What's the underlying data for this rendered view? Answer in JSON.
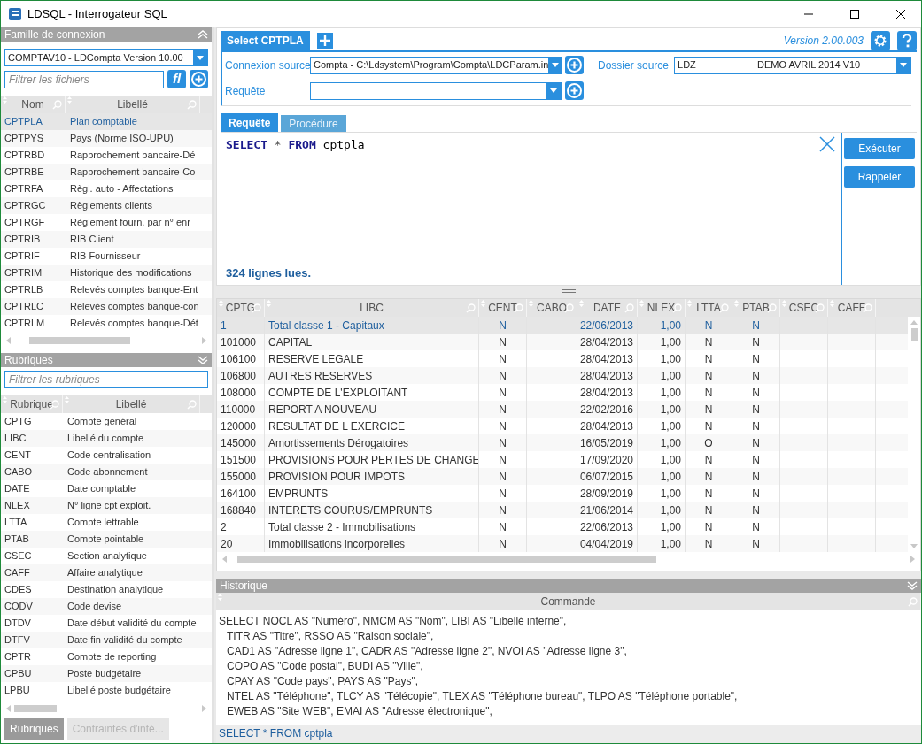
{
  "window": {
    "title": "LDSQL - Interrogateur SQL"
  },
  "connection_family": {
    "title": "Famille de connexion",
    "family": "COMPTAV10 - LDCompta Version 10.00",
    "filter": {
      "placeholder": "Filtrer les fichiers"
    },
    "filter_button": "fl",
    "columns": [
      "Nom",
      "Libellé"
    ],
    "rows": [
      {
        "name": "CPTPLA",
        "label": "Plan comptable",
        "selected": true
      },
      {
        "name": "CPTPYS",
        "label": "Pays (Norme ISO-UPU)",
        "selected": false
      },
      {
        "name": "CPTRBD",
        "label": "Rapprochement bancaire-Dé",
        "selected": false
      },
      {
        "name": "CPTRBE",
        "label": "Rapprochement bancaire-Co",
        "selected": false
      },
      {
        "name": "CPTRFA",
        "label": "Règl. auto - Affectations",
        "selected": false
      },
      {
        "name": "CPTRGC",
        "label": "Règlements clients",
        "selected": false
      },
      {
        "name": "CPTRGF",
        "label": "Règlement fourn. par n° enr",
        "selected": false
      },
      {
        "name": "CPTRIB",
        "label": "RIB Client",
        "selected": false
      },
      {
        "name": "CPTRIF",
        "label": "RIB Fournisseur",
        "selected": false
      },
      {
        "name": "CPTRIM",
        "label": "Historique des modifications",
        "selected": false
      },
      {
        "name": "CPTRLB",
        "label": "Relevés comptes banque-Ent",
        "selected": false
      },
      {
        "name": "CPTRLC",
        "label": "Relevés comptes banque-con",
        "selected": false
      },
      {
        "name": "CPTRLM",
        "label": "Relevés comptes banque-Dét",
        "selected": false
      }
    ]
  },
  "rubriques": {
    "title": "Rubriques",
    "filter": {
      "placeholder": "Filtrer les rubriques"
    },
    "columns": [
      "Rubrique",
      "Libellé"
    ],
    "rows": [
      {
        "code": "CPTG",
        "label": "Compte général"
      },
      {
        "code": "LIBC",
        "label": "Libellé du compte"
      },
      {
        "code": "CENT",
        "label": "Code centralisation"
      },
      {
        "code": "CABO",
        "label": "Code abonnement"
      },
      {
        "code": "DATE",
        "label": "Date comptable"
      },
      {
        "code": "NLEX",
        "label": "N° ligne cpt exploit."
      },
      {
        "code": "LTTA",
        "label": "Compte lettrable"
      },
      {
        "code": "PTAB",
        "label": "Compte pointable"
      },
      {
        "code": "CSEC",
        "label": "Section analytique"
      },
      {
        "code": "CAFF",
        "label": "Affaire analytique"
      },
      {
        "code": "CDES",
        "label": "Destination analytique"
      },
      {
        "code": "CODV",
        "label": "Code devise"
      },
      {
        "code": "DTDV",
        "label": "Date début validité du compte"
      },
      {
        "code": "DTFV",
        "label": "Date fin validité du compte"
      },
      {
        "code": "CPTR",
        "label": "Compte de reporting"
      },
      {
        "code": "CPBU",
        "label": "Poste budgétaire"
      },
      {
        "code": "LPBU",
        "label": "Libellé poste budgétaire"
      }
    ]
  },
  "bottom_tabs": [
    {
      "label": "Rubriques",
      "selected": true
    },
    {
      "label": "Contraintes d'inté...",
      "selected": false
    }
  ],
  "query_tabs": [
    {
      "label": "Select CPTPLA",
      "selected": true
    }
  ],
  "version": "Version 2.00.003",
  "connexion_source": {
    "label": "Connexion source",
    "value": "Compta - C:\\Ldsystem\\Program\\Compta\\LDCParam.in"
  },
  "dossier_source": {
    "label": "Dossier source",
    "code": "LDZ",
    "name": "DEMO AVRIL 2014 V10"
  },
  "requete": {
    "label": "Requête"
  },
  "editor_tabs": [
    {
      "label": "Requête",
      "selected": true
    },
    {
      "label": "Procédure",
      "selected": false
    }
  ],
  "sql": [
    {
      "text": "SELECT",
      "kind": "keyword"
    },
    {
      "text": "*",
      "kind": "operator"
    },
    {
      "text": "FROM",
      "kind": "keyword"
    },
    {
      "text": "cptpla",
      "kind": "identifier"
    }
  ],
  "buttons": [
    "Exécuter",
    "Rappeler"
  ],
  "status": "324 lignes lues.",
  "results": {
    "columns": [
      "CPTG",
      "LIBC",
      "CENT",
      "CABO",
      "DATE",
      "NLEX",
      "LTTA",
      "PTAB",
      "CSEC",
      "CAFF"
    ],
    "rows": [
      {
        "selected": true,
        "cells": {
          "cptg": "1",
          "libc": "Total classe 1 - Capitaux",
          "cent": "N",
          "date": "22/06/2013",
          "nlex": "1,00",
          "ltta": "N",
          "ptab": "N"
        }
      },
      {
        "selected": false,
        "cells": {
          "cptg": "101000",
          "libc": "CAPITAL",
          "cent": "N",
          "date": "28/04/2013",
          "nlex": "1,00",
          "ltta": "N",
          "ptab": "N"
        }
      },
      {
        "selected": false,
        "cells": {
          "cptg": "106100",
          "libc": "RESERVE LEGALE",
          "cent": "N",
          "date": "28/04/2013",
          "nlex": "1,00",
          "ltta": "N",
          "ptab": "N"
        }
      },
      {
        "selected": false,
        "cells": {
          "cptg": "106800",
          "libc": "AUTRES RESERVES",
          "cent": "N",
          "date": "28/04/2013",
          "nlex": "1,00",
          "ltta": "N",
          "ptab": "N"
        }
      },
      {
        "selected": false,
        "cells": {
          "cptg": "108000",
          "libc": "COMPTE DE L'EXPLOITANT",
          "cent": "N",
          "date": "28/04/2013",
          "nlex": "1,00",
          "ltta": "N",
          "ptab": "N"
        }
      },
      {
        "selected": false,
        "cells": {
          "cptg": "110000",
          "libc": "REPORT A NOUVEAU",
          "cent": "N",
          "date": "22/02/2016",
          "nlex": "1,00",
          "ltta": "N",
          "ptab": "N"
        }
      },
      {
        "selected": false,
        "cells": {
          "cptg": "120000",
          "libc": "RESULTAT DE L EXERCICE",
          "cent": "N",
          "date": "28/04/2013",
          "nlex": "1,00",
          "ltta": "N",
          "ptab": "N"
        }
      },
      {
        "selected": false,
        "cells": {
          "cptg": "145000",
          "libc": "Amortissements Dérogatoires",
          "cent": "N",
          "date": "16/05/2019",
          "nlex": "1,00",
          "ltta": "O",
          "ptab": "N"
        }
      },
      {
        "selected": false,
        "cells": {
          "cptg": "151500",
          "libc": "PROVISIONS POUR PERTES DE CHANGE",
          "cent": "N",
          "date": "17/09/2020",
          "nlex": "1,00",
          "ltta": "N",
          "ptab": "N"
        }
      },
      {
        "selected": false,
        "cells": {
          "cptg": "155000",
          "libc": "PROVISION POUR IMPOTS",
          "cent": "N",
          "date": "06/07/2015",
          "nlex": "1,00",
          "ltta": "N",
          "ptab": "N"
        }
      },
      {
        "selected": false,
        "cells": {
          "cptg": "164100",
          "libc": "EMPRUNTS",
          "cent": "N",
          "date": "28/09/2019",
          "nlex": "1,00",
          "ltta": "N",
          "ptab": "N"
        }
      },
      {
        "selected": false,
        "cells": {
          "cptg": "168840",
          "libc": "INTERETS COURUS/EMPRUNTS",
          "cent": "N",
          "date": "21/06/2014",
          "nlex": "1,00",
          "ltta": "N",
          "ptab": "N"
        }
      },
      {
        "selected": false,
        "cells": {
          "cptg": "2",
          "libc": "Total classe 2 - Immobilisations",
          "cent": "N",
          "date": "22/06/2013",
          "nlex": "1,00",
          "ltta": "N",
          "ptab": "N"
        }
      },
      {
        "selected": false,
        "cells": {
          "cptg": "20",
          "libc": "Immobilisations incorporelles",
          "cent": "N",
          "date": "04/04/2019",
          "nlex": "1,00",
          "ltta": "N",
          "ptab": "N"
        }
      }
    ]
  },
  "history": {
    "title": "Historique",
    "column": "Commande",
    "entries": [
      {
        "selected": false,
        "lines": [
          "SELECT NOCL AS \"Numéro\", NMCM AS \"Nom\", LIBI AS \"Libellé interne\",",
          "TITR AS \"Titre\", RSSO AS \"Raison sociale\",",
          "CAD1 AS \"Adresse ligne 1\", CADR AS \"Adresse ligne 2\", NVOI AS \"Adresse ligne 3\",",
          "COPO AS \"Code postal\", BUDI AS \"Ville\",",
          "CPAY AS \"Code pays\", PAYS AS \"Pays\",",
          "NTEL AS \"Téléphone\", TLCY AS \"Télécopie\", TLEX AS \"Téléphone bureau\", TLPO AS \"Téléphone portable\",",
          "EWEB AS \"Site WEB\", EMAI AS \"Adresse électronique\","
        ]
      },
      {
        "selected": true,
        "lines": [
          "SELECT * FROM cptpla"
        ]
      }
    ]
  }
}
